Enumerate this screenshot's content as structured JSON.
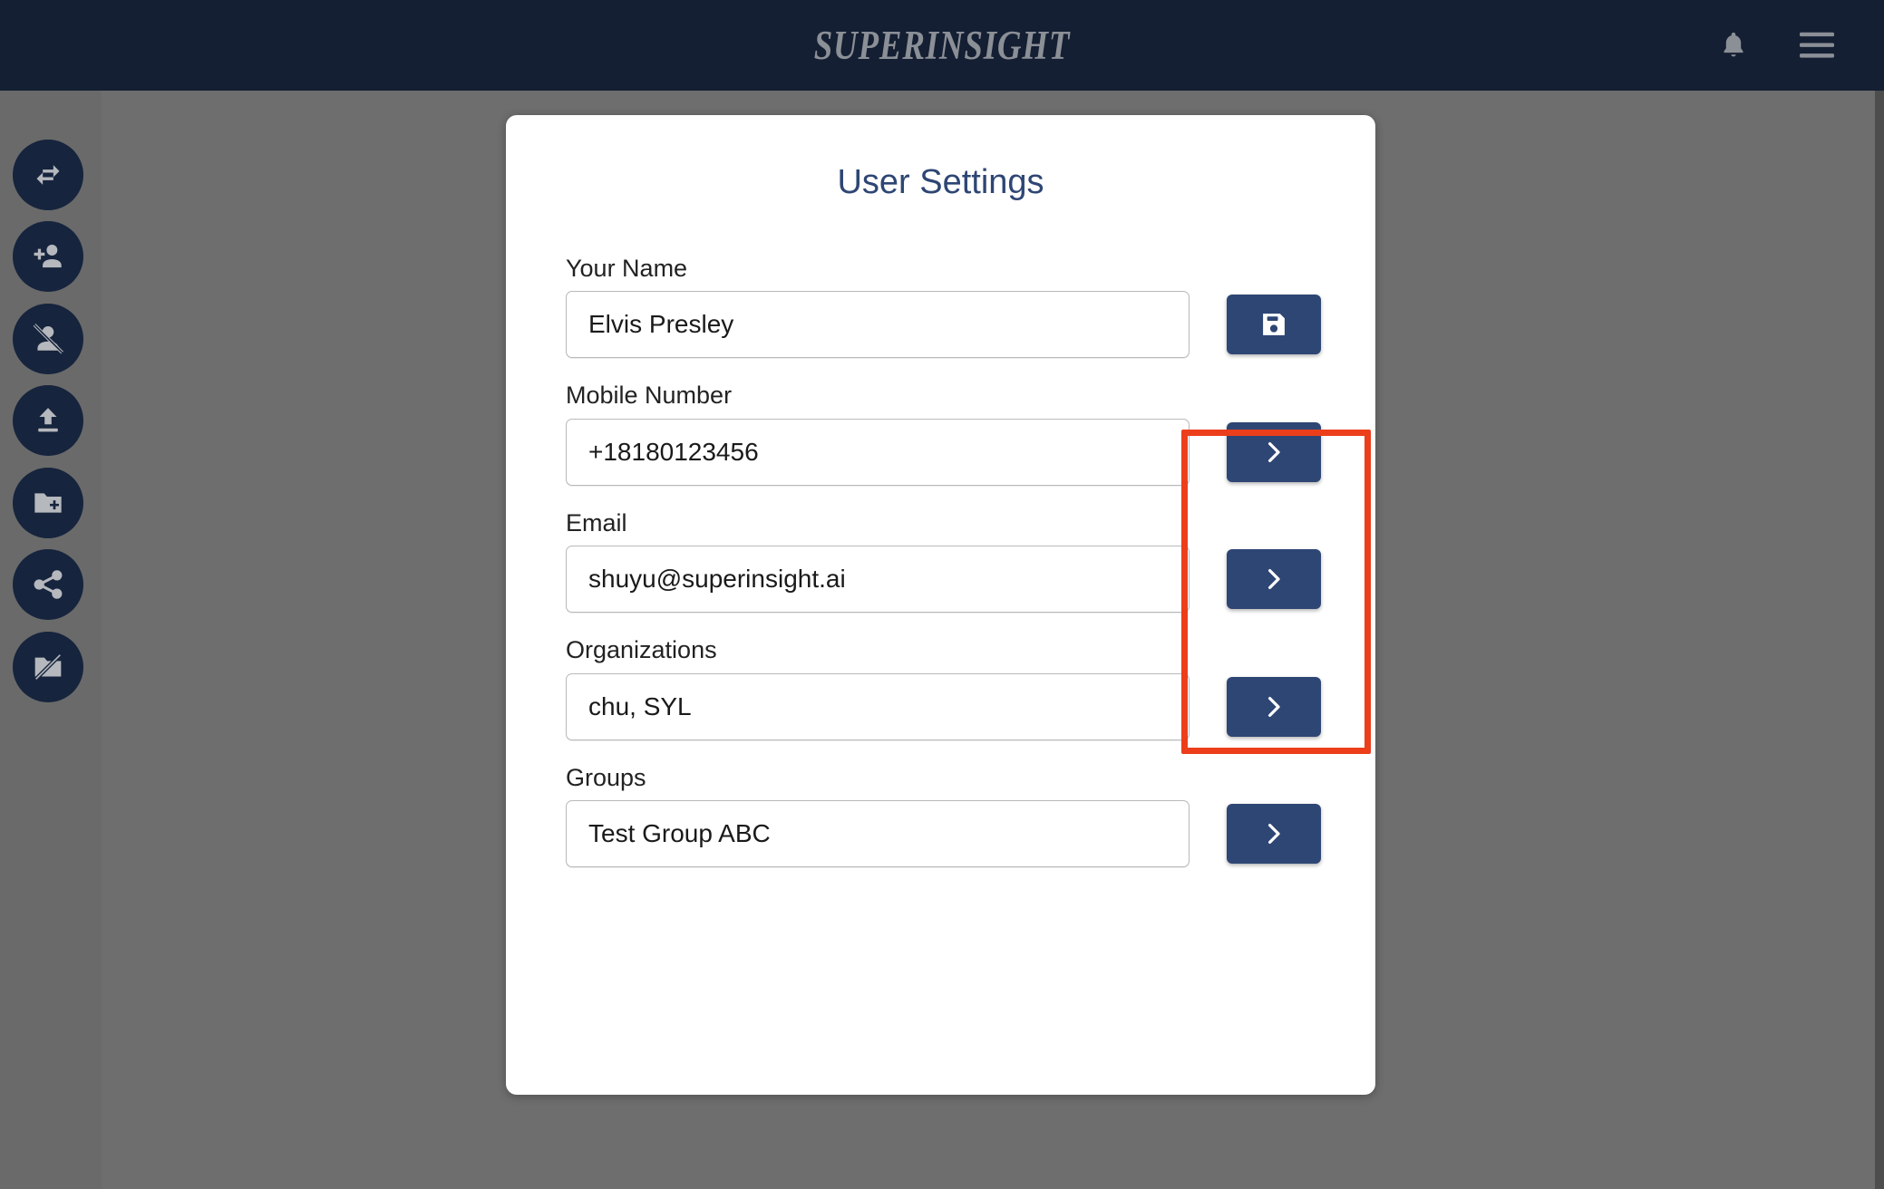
{
  "header": {
    "brand": "SUPERINSIGHT",
    "notifications_icon": "bell-icon",
    "menu_icon": "hamburger-menu-icon",
    "background_color": "#141f33",
    "brand_color": "#8b8f96"
  },
  "sidebar": {
    "background_color": "#6a6a6a",
    "item_color": "#16243d",
    "items": [
      {
        "name": "transfer-icon",
        "label": "Transfer"
      },
      {
        "name": "person-add-icon",
        "label": "Add User"
      },
      {
        "name": "person-off-icon",
        "label": "Remove User"
      },
      {
        "name": "upload-icon",
        "label": "Upload"
      },
      {
        "name": "folder-add-icon",
        "label": "New Folder"
      },
      {
        "name": "share-icon",
        "label": "Share"
      },
      {
        "name": "folder-off-icon",
        "label": "Unshare Folder"
      }
    ]
  },
  "card": {
    "title": "User Settings",
    "title_color": "#2e4674",
    "accent_color": "#2e4674",
    "fields": [
      {
        "id": "your-name",
        "label": "Your Name",
        "value": "Elvis Presley",
        "placeholder": "Your Name",
        "action": "save",
        "action_icon": "save-floppy-icon"
      },
      {
        "id": "mobile-number",
        "label": "Mobile Number",
        "value": "+18180123456",
        "placeholder": "Mobile Number",
        "action": "next",
        "action_icon": "chevron-right-icon"
      },
      {
        "id": "email",
        "label": "Email",
        "value": "shuyu@superinsight.ai",
        "placeholder": "Email",
        "action": "next",
        "action_icon": "chevron-right-icon"
      },
      {
        "id": "organizations",
        "label": "Organizations",
        "value": "chu, SYL",
        "placeholder": "Organizations",
        "action": "next",
        "action_icon": "chevron-right-icon"
      },
      {
        "id": "groups",
        "label": "Groups",
        "value": "Test Group ABC",
        "placeholder": "Groups",
        "action": "next",
        "action_icon": "chevron-right-icon"
      }
    ]
  },
  "annotation": {
    "name": "red-highlight-box",
    "color": "#ec3e1b"
  },
  "page": {
    "background_color": "#6e6e6e"
  }
}
